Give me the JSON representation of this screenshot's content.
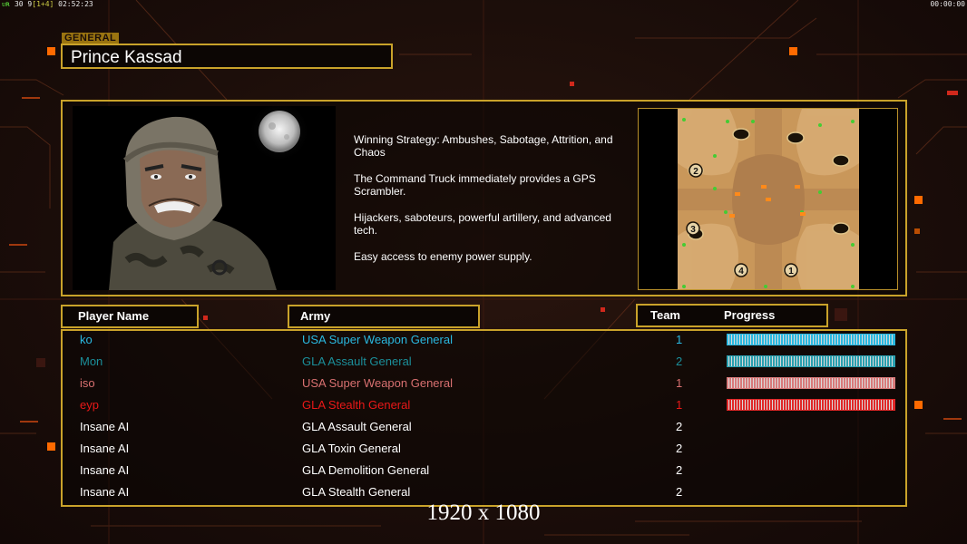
{
  "hud": {
    "fps_label": "ᴜʀ",
    "fps_value": "30",
    "frames": "9",
    "frame_extra": "[1+4]",
    "clock": "02:52:23",
    "timer": "00:00:00"
  },
  "general": {
    "tag": "GENERAL",
    "name": "Prince Kassad",
    "description": [
      "Winning Strategy: Ambushes, Sabotage, Attrition, and\n Chaos",
      "The Command Truck immediately provides a GPS\n Scrambler.",
      "Hijackers, saboteurs, powerful artillery, and advanced\n tech.",
      "Easy access to enemy power supply."
    ]
  },
  "map": {
    "start_positions": [
      "1",
      "2",
      "3",
      "4"
    ]
  },
  "headers": {
    "player_name": "Player Name",
    "army": "Army",
    "team": "Team",
    "progress": "Progress"
  },
  "players": [
    {
      "name": "ko",
      "army": "USA Super Weapon General",
      "team": "1",
      "color": "#2ab8e0",
      "progress": 1.0,
      "bar_color": "#2ab8e0"
    },
    {
      "name": "Mon",
      "army": "GLA Assault General",
      "team": "2",
      "color": "#1b8f9a",
      "progress": 1.0,
      "bar_color": "#2aa0b0"
    },
    {
      "name": "iso",
      "army": "USA Super Weapon General",
      "team": "1",
      "color": "#d87070",
      "progress": 1.0,
      "bar_color": "#d87a7a"
    },
    {
      "name": "eyp",
      "army": "GLA Stealth General",
      "team": "1",
      "color": "#e81818",
      "progress": 1.0,
      "bar_color": "#e02828"
    },
    {
      "name": "Insane AI",
      "army": "GLA Assault General",
      "team": "2",
      "color": "#ffffff"
    },
    {
      "name": "Insane AI",
      "army": "GLA Toxin General",
      "team": "2",
      "color": "#ffffff"
    },
    {
      "name": "Insane AI",
      "army": "GLA Demolition General",
      "team": "2",
      "color": "#ffffff"
    },
    {
      "name": "Insane AI",
      "army": "GLA Stealth General",
      "team": "2",
      "color": "#ffffff"
    }
  ],
  "resolution_label": "1920 x 1080",
  "colors": {
    "frame": "#c9a22a",
    "accent_orange": "#ff6a00",
    "background": "#1a0d09"
  }
}
